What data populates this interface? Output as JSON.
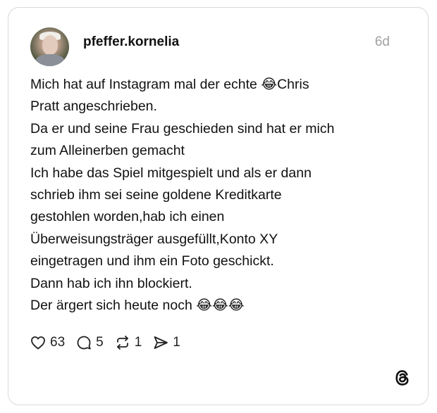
{
  "post": {
    "username": "pfeffer.kornelia",
    "time": "6d",
    "text": "Mich hat auf Instagram mal der echte 😂Chris\nPratt angeschrieben.\nDa er und seine Frau geschieden sind hat er mich\nzum Alleinerben gemacht\nIch habe das Spiel mitgespielt und als er dann\nschrieb ihm sei seine goldene Kreditkarte\ngestohlen worden,hab ich einen\nÜberweisungsträger ausgefüllt,Konto XY\neingetragen und ihm ein Foto geschickt.\nDann hab ich ihn blockiert.\nDer ärgert sich heute noch 😂😂😂"
  },
  "actions": {
    "likes": "63",
    "replies": "5",
    "reposts": "1",
    "shares": "1"
  },
  "icons": {
    "like": "heart-icon",
    "reply": "comment-bubble-icon",
    "repost": "repost-icon",
    "share": "send-icon",
    "brand": "threads-logo-icon"
  },
  "colors": {
    "text": "#111111",
    "muted": "#a0a0a0",
    "border": "#d9d9d9"
  }
}
